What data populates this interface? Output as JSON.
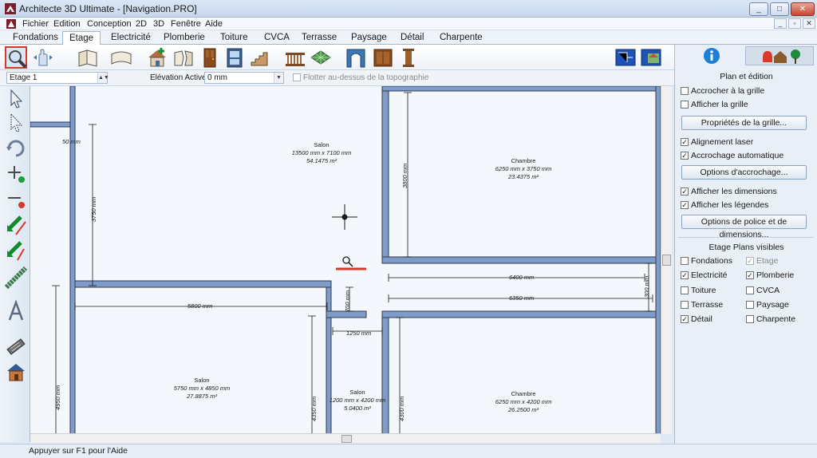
{
  "window": {
    "title": "Architecte 3D Ultimate - [Navigation.PRO]",
    "controls": [
      "_",
      "□",
      "✕"
    ],
    "mdi_controls": [
      "_",
      "▫",
      "✕"
    ]
  },
  "menu": [
    "Fichier",
    "Edition",
    "Conception",
    "2D",
    "3D",
    "Fenêtre",
    "Aide"
  ],
  "tabs": [
    "Fondations",
    "Etage",
    "Electricité",
    "Plomberie",
    "Toiture",
    "CVCA",
    "Terrasse",
    "Paysage",
    "Détail",
    "Charpente"
  ],
  "active_tab": "Etage",
  "toolbar2": {
    "level": "Etage 1",
    "elevation_label": "Elévation Active:",
    "elevation_value": "0 mm",
    "float_label": "Flotter au-dessus de la topographie"
  },
  "plan": {
    "rooms": [
      {
        "name": "Salon",
        "dims": "13500 mm x 7100 mm",
        "area": "54.1475 m²"
      },
      {
        "name": "Chambre",
        "dims": "6250 mm x 3750 mm",
        "area": "23.4375 m²"
      },
      {
        "name": "Salon",
        "dims": "5750 mm x 4850 mm",
        "area": "27.8875 m²"
      },
      {
        "name": "Salon",
        "dims": "1200 mm x 4200 mm",
        "area": "5.0400 m²"
      },
      {
        "name": "Chambre",
        "dims": "6250 mm x 4200 mm",
        "area": "26.2500 m²"
      }
    ],
    "dimensions": {
      "d50": "50 mm",
      "d3750": "3750 mm",
      "d3800": "3800 mm",
      "d6400": "6400 mm",
      "d6350": "6350 mm",
      "d5800": "5800 mm",
      "d700": "700 mm",
      "d1250": "1250 mm",
      "d300": "300 mm",
      "d4950": "4950 mm",
      "d4350": "4350 mm",
      "d4300": "4300 mm"
    }
  },
  "status": "Appuyer sur F1 pour l'Aide",
  "panel": {
    "title": "Plan et édition",
    "snap_grid": "Accrocher à la grille",
    "show_grid": "Afficher la grille",
    "grid_props": "Propriétés de la grille...",
    "laser": "Alignement laser",
    "auto_snap": "Accrochage automatique",
    "snap_options": "Options d'accrochage...",
    "show_dims": "Afficher les dimensions",
    "show_legends": "Afficher les légendes",
    "font_options": "Options de police et de dimensions...",
    "visible_title": "Etage Plans visibles",
    "layers": [
      {
        "label": "Fondations",
        "checked": false,
        "dim": false
      },
      {
        "label": "Etage",
        "checked": true,
        "dim": true
      },
      {
        "label": "Electricité",
        "checked": true,
        "dim": false
      },
      {
        "label": "Plomberie",
        "checked": true,
        "dim": false
      },
      {
        "label": "Toiture",
        "checked": false,
        "dim": false
      },
      {
        "label": "CVCA",
        "checked": false,
        "dim": false
      },
      {
        "label": "Terrasse",
        "checked": false,
        "dim": false
      },
      {
        "label": "Paysage",
        "checked": false,
        "dim": false
      },
      {
        "label": "Détail",
        "checked": true,
        "dim": false
      },
      {
        "label": "Charpente",
        "checked": false,
        "dim": false
      }
    ],
    "check_mark": "✓"
  },
  "colors": {
    "wall": "#7f9cc9",
    "wall_edge": "#2d3a52",
    "selected_border": "#d43a2a",
    "cursor_underline": "#d43a2a"
  }
}
